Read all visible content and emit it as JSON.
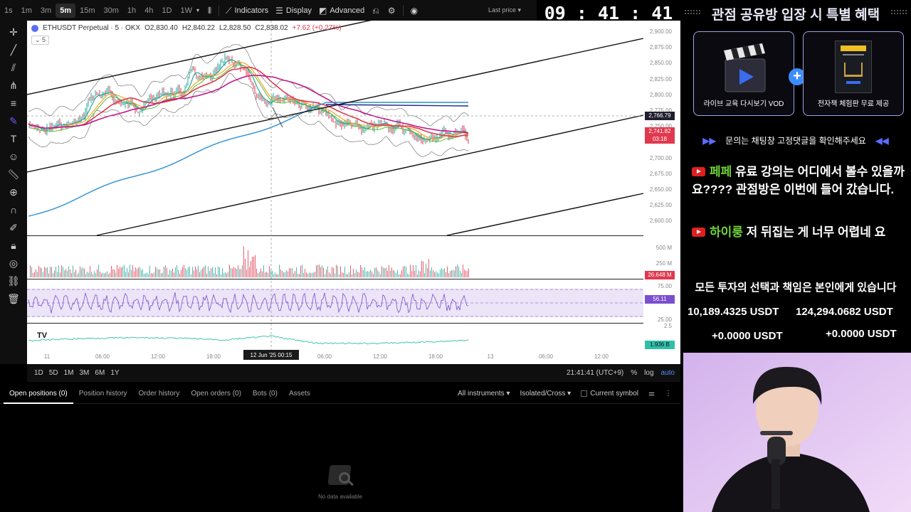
{
  "toolbar": {
    "timeframes": [
      "1s",
      "1m",
      "3m",
      "5m",
      "15m",
      "30m",
      "1h",
      "4h",
      "1D",
      "1W"
    ],
    "active_timeframe": "5m",
    "indicators_label": "Indicators",
    "display_label": "Display",
    "advanced_label": "Advanced",
    "last_price_label": "Last price"
  },
  "clock": "09 : 41 : 41 pm",
  "chart": {
    "symbol": "ETHUSDT Perpetual · 5 · OKX",
    "ohlc": {
      "o": "O2,830.40",
      "h": "H2,840.22",
      "l": "L2,828.50",
      "c": "C2,838.02",
      "chg": "+7.62 (+0.27%)"
    },
    "indicator_count": "5",
    "price_ticks": [
      "2,900.00",
      "2,875.00",
      "2,850.00",
      "2,825.00",
      "2,800.00",
      "2,775.00",
      "2,750.00",
      "2,725.00",
      "2,700.00",
      "2,675.00",
      "2,650.00",
      "2,625.00",
      "2,600.00"
    ],
    "price_tag_dark": "2,766.79",
    "price_tag_red": "2,741.82",
    "price_tag_timer": "03:18",
    "volume_ticks": [
      "500 M",
      "250 M"
    ],
    "volume_tag": "26.648 M",
    "rsi_ticks": [
      "75.00",
      "25.00"
    ],
    "rsi_tag": "56.11",
    "osc_tick": "2.5",
    "osc_tag": "1.936 B",
    "time_ticks": [
      "11",
      "06:00",
      "12:00",
      "18:00",
      "06:00",
      "12:00",
      "18:00",
      "13",
      "06:00",
      "12:00"
    ],
    "crosshair_time": "12 Jun '25   00:15"
  },
  "range_bar": {
    "ranges": [
      "1D",
      "5D",
      "1M",
      "3M",
      "6M",
      "1Y"
    ],
    "time": "21:41:41 (UTC+9)",
    "percent": "%",
    "log": "log",
    "auto": "auto"
  },
  "tabs": {
    "items": [
      "Open positions (0)",
      "Position history",
      "Order history",
      "Open orders (0)",
      "Bots (0)",
      "Assets"
    ],
    "all_instruments": "All instruments",
    "margin_mode": "Isolated/Cross",
    "current_symbol": "Current symbol",
    "no_data": "No data available"
  },
  "stream": {
    "title": "관점 공유방 입장 시 특별 혜택",
    "card1_caption": "라이브 교육 다시보기 VOD",
    "card2_caption": "전자책 체험판 무료 제공",
    "notice": "문의는 채팅창 고정댓글을 확인해주세요",
    "chat": [
      {
        "user": "페페",
        "text": "유료 강의는 어디에서 볼수 있을까요???? 관점방은 이번에 들어 갔습니다."
      },
      {
        "user": "하이룽",
        "text": "저 뒤집는 게 너무 어렵네 요"
      }
    ],
    "disclaimer": "모든 투자의 선택과 책임은 본인에게 있습니다",
    "balances": [
      "10,189.4325 USDT",
      "124,294.0682 USDT",
      "+0.0000 USDT",
      "+0.0000 USDT"
    ]
  },
  "colors": {
    "accent": "#6a5cff",
    "up": "#26a69a",
    "down": "#e0394e",
    "panel": "#0f0f0f"
  }
}
